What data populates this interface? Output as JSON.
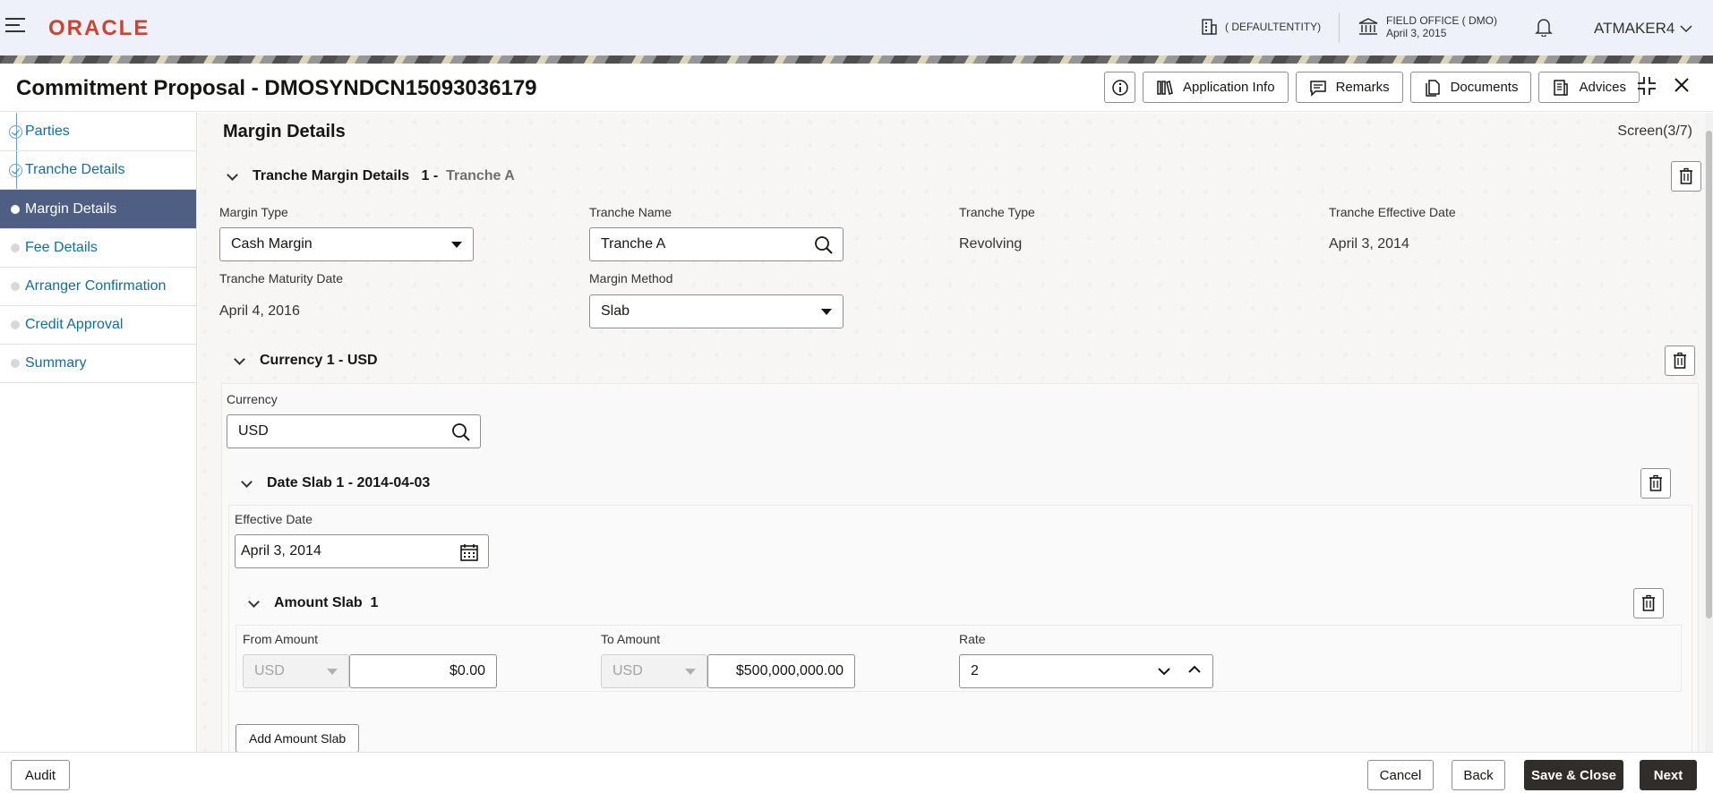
{
  "topbar": {
    "logo": "ORACLE",
    "entity": "( DEFAULTENTITY)",
    "office_name": "FIELD OFFICE ( DMO)",
    "office_date": "April 3, 2015",
    "user": "ATMAKER4"
  },
  "header": {
    "title": "Commitment Proposal - DMOSYNDCN15093036179",
    "buttons": {
      "application_info": "Application Info",
      "remarks": "Remarks",
      "documents": "Documents",
      "advices": "Advices"
    }
  },
  "sidebar": {
    "items": [
      {
        "label": "Parties",
        "state": "done"
      },
      {
        "label": "Tranche Details",
        "state": "done"
      },
      {
        "label": "Margin Details",
        "state": "active"
      },
      {
        "label": "Fee Details",
        "state": "pending"
      },
      {
        "label": "Arranger Confirmation",
        "state": "pending"
      },
      {
        "label": "Credit Approval",
        "state": "pending"
      },
      {
        "label": "Summary",
        "state": "pending"
      }
    ]
  },
  "main": {
    "section_title": "Margin Details",
    "screen_count": "Screen(3/7)",
    "tranche": {
      "title": "Tranche Margin Details",
      "index": "1 -",
      "name_muted": "Tranche A",
      "margin_type_label": "Margin Type",
      "margin_type_value": "Cash Margin",
      "tranche_name_label": "Tranche Name",
      "tranche_name_value": "Tranche A",
      "tranche_type_label": "Tranche Type",
      "tranche_type_value": "Revolving",
      "effective_date_label": "Tranche Effective Date",
      "effective_date_value": "April 3, 2014",
      "maturity_date_label": "Tranche Maturity Date",
      "maturity_date_value": "April 4, 2016",
      "margin_method_label": "Margin Method",
      "margin_method_value": "Slab"
    },
    "currency": {
      "title": "Currency 1 - USD",
      "label": "Currency",
      "value": "USD"
    },
    "date_slab": {
      "title": "Date Slab 1 - 2014-04-03",
      "effective_date_label": "Effective Date",
      "effective_date_value": "April 3, 2014"
    },
    "amount_slab": {
      "title": "Amount Slab  1",
      "from_label": "From Amount",
      "from_ccy": "USD",
      "from_value": "$0.00",
      "to_label": "To Amount",
      "to_ccy": "USD",
      "to_value": "$500,000,000.00",
      "rate_label": "Rate",
      "rate_value": "2"
    },
    "add_amount_slab": "Add Amount Slab"
  },
  "footer": {
    "audit": "Audit",
    "cancel": "Cancel",
    "back": "Back",
    "save_close": "Save & Close",
    "next": "Next"
  }
}
